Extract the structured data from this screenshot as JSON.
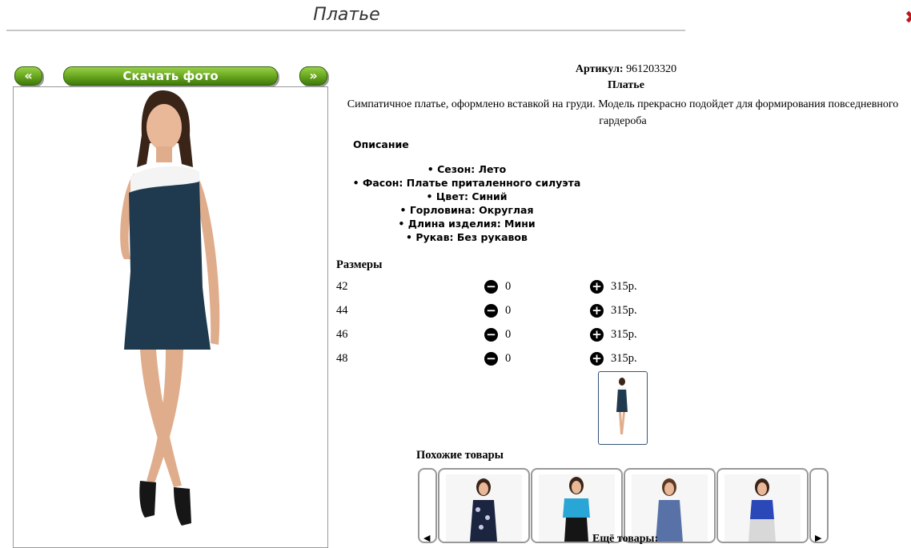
{
  "header": {
    "title": "Платье"
  },
  "photo_nav": {
    "prev_label": "«",
    "download_label": "Скачать фото",
    "next_label": "»"
  },
  "product": {
    "article_label": "Артикул:",
    "article_value": "961203320",
    "name": "Платье",
    "description": "Симпатичное платье, оформлено вставкой на груди. Модель прекрасно подойдет для формирования повседневного гардероба",
    "description_heading": "Описание",
    "specs": [
      "Сезон: Лето",
      "Фасон: Платье приталенного силуэта",
      "Цвет: Синий",
      "Горловина: Округлая",
      "Длина изделия: Мини",
      "Рукав: Без рукавов"
    ]
  },
  "sizes": {
    "heading": "Размеры",
    "rows": [
      {
        "size": "42",
        "qty": "0",
        "price": "315р."
      },
      {
        "size": "44",
        "qty": "0",
        "price": "315р."
      },
      {
        "size": "46",
        "qty": "0",
        "price": "315р."
      },
      {
        "size": "48",
        "qty": "0",
        "price": "315р."
      }
    ]
  },
  "similar": {
    "heading": "Похожие товары",
    "more_label": "Ещё товары:"
  },
  "icons": {
    "minus": "minus-circle-icon",
    "plus": "plus-circle-icon"
  },
  "colors": {
    "button_green": "#6aa81f",
    "dress_navy": "#1f3a4f",
    "collar_white": "#f4f4f4",
    "title_rule": "#c8c8c8"
  }
}
